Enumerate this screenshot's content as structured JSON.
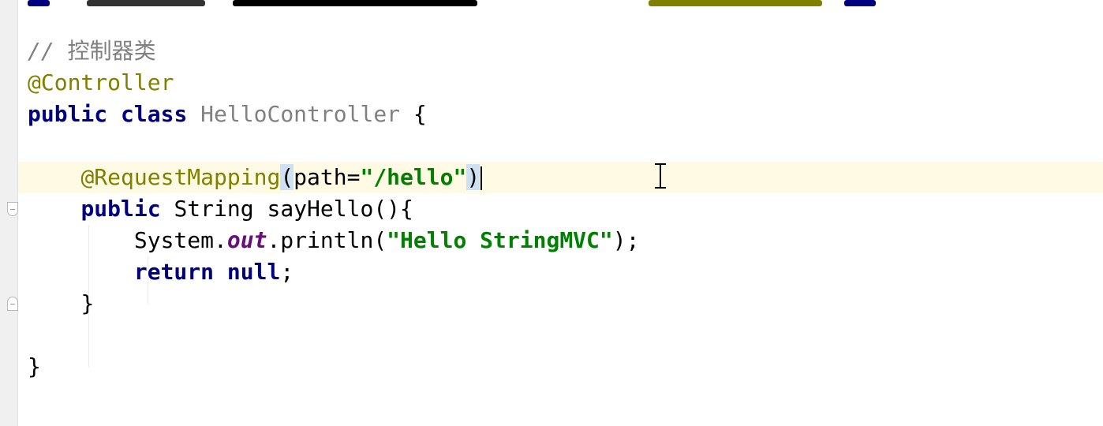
{
  "editor": {
    "lines": {
      "comment_slashes": "// ",
      "comment_text": "控制器类",
      "controller_annotation": "@Controller",
      "class_kw_public": "public",
      "class_kw_class": "class",
      "class_name": "HelloController",
      "class_open_brace": "{",
      "mapping_annotation": "@RequestMapping",
      "mapping_open_paren": "(",
      "mapping_param": "path=",
      "mapping_value": "\"/hello\"",
      "mapping_close_paren": ")",
      "method_kw_public": "public",
      "method_signature": "String sayHello(){",
      "stmt_system": "System.",
      "stmt_out": "out",
      "stmt_println": ".println(",
      "stmt_string": "\"Hello StringMVC\"",
      "stmt_end": ");",
      "return_kw": "return",
      "null_kw": "null",
      "return_end": ";",
      "method_close_brace": "}",
      "class_close_brace": "}"
    }
  },
  "colors": {
    "keyword": "#000080",
    "annotation": "#808000",
    "comment": "#808080",
    "string": "#008000",
    "static_field": "#660e7a",
    "current_line_highlight": "#fffae3",
    "brace_match_highlight": "#cfdff4"
  },
  "icons": [
    "fold-open-icon",
    "fold-close-icon",
    "text-cursor-ibeam-icon"
  ]
}
